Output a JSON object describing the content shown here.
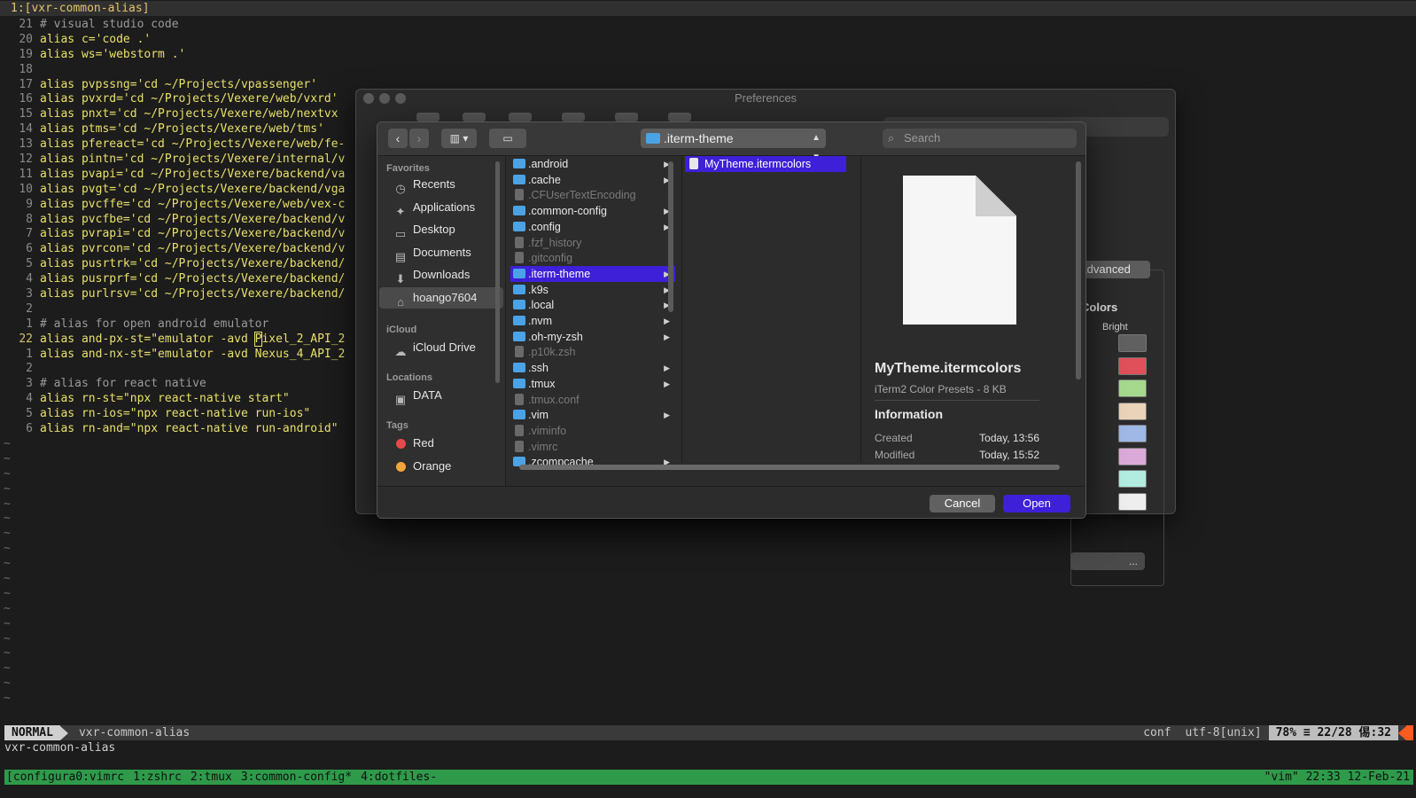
{
  "vim": {
    "tab_title": "1:[vxr-common-alias]",
    "lines": [
      {
        "ln": "21",
        "text": "# visual studio code",
        "comment": true
      },
      {
        "ln": "20",
        "text": "alias c='code .'"
      },
      {
        "ln": "19",
        "text": "alias ws='webstorm .'"
      },
      {
        "ln": "18",
        "text": ""
      },
      {
        "ln": "17",
        "text": "alias pvpssng='cd ~/Projects/vpassenger'"
      },
      {
        "ln": "16",
        "text": "alias pvxrd='cd ~/Projects/Vexere/web/vxrd'"
      },
      {
        "ln": "15",
        "text": "alias pnxt='cd ~/Projects/Vexere/web/nextvx"
      },
      {
        "ln": "14",
        "text": "alias ptms='cd ~/Projects/Vexere/web/tms'"
      },
      {
        "ln": "13",
        "text": "alias pfereact='cd ~/Projects/Vexere/web/fe-"
      },
      {
        "ln": "12",
        "text": "alias pintn='cd ~/Projects/Vexere/internal/v"
      },
      {
        "ln": "11",
        "text": "alias pvapi='cd ~/Projects/Vexere/backend/va"
      },
      {
        "ln": "10",
        "text": "alias pvgt='cd ~/Projects/Vexere/backend/vga"
      },
      {
        "ln": "9",
        "text": "alias pvcffe='cd ~/Projects/Vexere/web/vex-c"
      },
      {
        "ln": "8",
        "text": "alias pvcfbe='cd ~/Projects/Vexere/backend/v"
      },
      {
        "ln": "7",
        "text": "alias pvrapi='cd ~/Projects/Vexere/backend/v"
      },
      {
        "ln": "6",
        "text": "alias pvrcon='cd ~/Projects/Vexere/backend/v"
      },
      {
        "ln": "5",
        "text": "alias pusrtrk='cd ~/Projects/Vexere/backend/"
      },
      {
        "ln": "4",
        "text": "alias pusrprf='cd ~/Projects/Vexere/backend/"
      },
      {
        "ln": "3",
        "text": "alias purlrsv='cd ~/Projects/Vexere/backend/"
      },
      {
        "ln": "2",
        "text": ""
      },
      {
        "ln": "1",
        "text": "# alias for open android emulator",
        "comment": true
      },
      {
        "ln": "22",
        "text": "alias and-px-st=\"emulator -avd Pixel_2_API_2",
        "current": true
      },
      {
        "ln": "1",
        "text": "alias and-nx-st=\"emulator -avd Nexus_4_API_2"
      },
      {
        "ln": "2",
        "text": ""
      },
      {
        "ln": "3",
        "text": "# alias for react native",
        "comment": true
      },
      {
        "ln": "4",
        "text": "alias rn-st=\"npx react-native start\""
      },
      {
        "ln": "5",
        "text": "alias rn-ios=\"npx react-native run-ios\""
      },
      {
        "ln": "6",
        "text": "alias rn-and=\"npx react-native run-android\""
      }
    ],
    "tilde": "~",
    "status": {
      "mode": "NORMAL",
      "file": "vxr-common-alias",
      "filetype": "conf",
      "encoding": "utf-8[unix]",
      "position": "78% ≡ 22/28 㑥:32"
    },
    "cmdline": "vxr-common-alias"
  },
  "tmux": {
    "windows": [
      "[configura0:vimrc",
      "1:zshrc",
      "2:tmux",
      "3:common-config*",
      "4:dotfiles-"
    ],
    "right": "\"vim\" 22:33 12-Feb-21"
  },
  "prefs": {
    "title": "Preferences",
    "advanced_tab": "Advanced",
    "colors_title": "Colors",
    "bright_label": "Bright",
    "swatches": [
      "#606060",
      "#e0505a",
      "#a6d98e",
      "#ead3b8",
      "#9fb8e6",
      "#dcaad8",
      "#b2ece0",
      "#eeeeee"
    ],
    "select_value": "..."
  },
  "dialog": {
    "path": ".iterm-theme",
    "search_placeholder": "Search",
    "sidebar": {
      "favorites_label": "Favorites",
      "favorites": [
        {
          "label": "Recents",
          "icon": "clock-icon"
        },
        {
          "label": "Applications",
          "icon": "applications-icon"
        },
        {
          "label": "Desktop",
          "icon": "desktop-icon"
        },
        {
          "label": "Documents",
          "icon": "documents-icon"
        },
        {
          "label": "Downloads",
          "icon": "downloads-icon"
        },
        {
          "label": "hoango7604",
          "icon": "home-icon"
        }
      ],
      "icloud_label": "iCloud",
      "icloud_drive": "iCloud Drive",
      "locations_label": "Locations",
      "data_drive": "DATA",
      "tags_label": "Tags",
      "tags": [
        {
          "label": "Red",
          "color": "#e84a4a"
        },
        {
          "label": "Orange",
          "color": "#f2a53a"
        }
      ]
    },
    "files": [
      {
        "name": ".android",
        "folder": true
      },
      {
        "name": ".cache",
        "folder": true
      },
      {
        "name": ".CFUserTextEncoding",
        "folder": false
      },
      {
        "name": ".common-config",
        "folder": true
      },
      {
        "name": ".config",
        "folder": true
      },
      {
        "name": ".fzf_history",
        "folder": false
      },
      {
        "name": ".gitconfig",
        "folder": false
      },
      {
        "name": ".iterm-theme",
        "folder": true,
        "selected": true
      },
      {
        "name": ".k9s",
        "folder": true
      },
      {
        "name": ".local",
        "folder": true
      },
      {
        "name": ".nvm",
        "folder": true
      },
      {
        "name": ".oh-my-zsh",
        "folder": true
      },
      {
        "name": ".p10k.zsh",
        "folder": false
      },
      {
        "name": ".ssh",
        "folder": true
      },
      {
        "name": ".tmux",
        "folder": true
      },
      {
        "name": ".tmux.conf",
        "folder": false
      },
      {
        "name": ".vim",
        "folder": true
      },
      {
        "name": ".viminfo",
        "folder": false
      },
      {
        "name": ".vimrc",
        "folder": false
      },
      {
        "name": ".zcompcache",
        "folder": true
      }
    ],
    "selected_file": "MyTheme.itermcolors",
    "preview": {
      "name": "MyTheme.itermcolors",
      "kind": "iTerm2 Color Presets - 8 KB",
      "info_title": "Information",
      "created_label": "Created",
      "created_value": "Today, 13:56",
      "modified_label": "Modified",
      "modified_value": "Today, 15:52"
    },
    "cancel_label": "Cancel",
    "open_label": "Open"
  }
}
